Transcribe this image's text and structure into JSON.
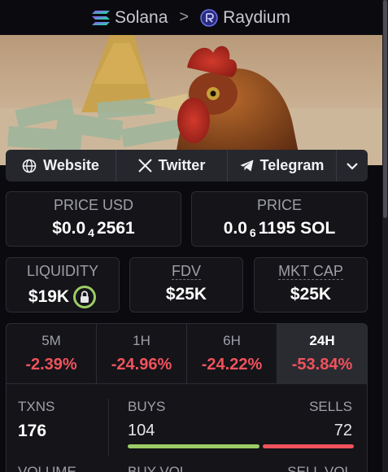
{
  "breadcrumb": {
    "chain": "Solana",
    "separator": ">",
    "dex": "Raydium"
  },
  "links": {
    "website": "Website",
    "twitter": "Twitter",
    "telegram": "Telegram"
  },
  "price_usd": {
    "label": "PRICE USD",
    "prefix": "$0.0",
    "zeros": "4",
    "digits": "2561"
  },
  "price_native": {
    "label": "PRICE",
    "prefix": "0.0",
    "zeros": "6",
    "digits": "1195 SOL"
  },
  "liquidity": {
    "label": "LIQUIDITY",
    "value": "$19K"
  },
  "fdv": {
    "label": "FDV",
    "value": "$25K"
  },
  "mkt_cap": {
    "label": "MKT CAP",
    "value": "$25K"
  },
  "timeframes": [
    {
      "label": "5M",
      "change": "-2.39%"
    },
    {
      "label": "1H",
      "change": "-24.96%"
    },
    {
      "label": "6H",
      "change": "-24.22%"
    },
    {
      "label": "24H",
      "change": "-53.84%"
    }
  ],
  "txns": {
    "label": "TXNS",
    "value": "176"
  },
  "buys": {
    "label": "BUYS",
    "value": "104",
    "fraction": 0.59
  },
  "sells": {
    "label": "SELLS",
    "value": "72",
    "fraction": 0.41
  },
  "next_row": {
    "volume": "VOLUME",
    "buy_vol": "BUY VOL",
    "sell_vol": "SELL VOL"
  },
  "colors": {
    "negative": "#f0525c",
    "buys_bar": "#9ccc65",
    "sells_bar": "#f0525c",
    "raydium": "#3b3fb0"
  },
  "icons": {
    "solana": "solana-icon",
    "raydium": "raydium-icon",
    "website": "globe-icon",
    "twitter": "x-icon",
    "telegram": "telegram-icon",
    "more": "chevron-down-icon",
    "lock": "lock-icon"
  }
}
